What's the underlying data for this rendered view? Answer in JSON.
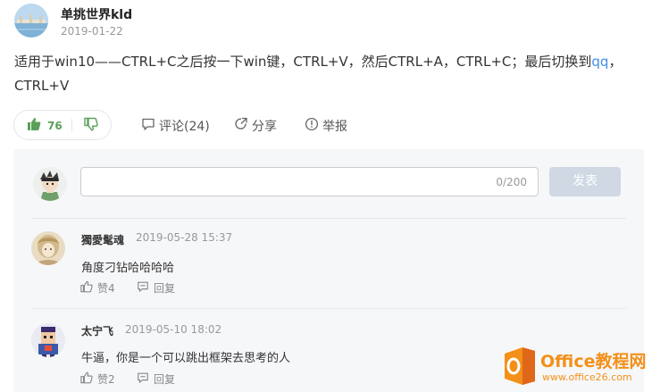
{
  "post": {
    "author": "单挑世界kld",
    "date": "2019-01-22",
    "body_main": "适用于win10——CTRL+C之后按一下win键，CTRL+V，然后CTRL+A，CTRL+C；最后切换到",
    "body_link": "qq",
    "body_tail": "，CTRL+V"
  },
  "actions": {
    "upvote_count": "76",
    "comment_label": "评论(24)",
    "share_label": "分享",
    "report_label": "举报"
  },
  "composer": {
    "counter": "0/200",
    "publish_label": "发表"
  },
  "comments": [
    {
      "user": "獨愛髦魂",
      "time": "2019-05-28 15:37",
      "text": "角度刁钻哈哈哈哈",
      "likes": "赞4",
      "reply": "回复"
    },
    {
      "user": "太宁飞",
      "time": "2019-05-10 18:02",
      "text": "牛逼，你是一个可以跳出框架去思考的人",
      "likes": "赞2",
      "reply": "回复"
    }
  ],
  "watermark": {
    "title": "Office教程网",
    "url": "www.office26.com"
  },
  "colors": {
    "accent_blue": "#3e8ee8",
    "upvote_green": "#5aa05a",
    "downvote_green": "#5aa05a",
    "publish_disabled": "#cfd8e3",
    "watermark_orange": "#f39019"
  },
  "icons": {
    "upvote": "thumbs-up-icon",
    "downvote": "thumbs-down-icon",
    "comment": "comment-bubble-icon",
    "share": "share-icon",
    "report": "exclamation-circle-icon",
    "like": "thumbs-up-outline-icon",
    "reply": "reply-bubble-icon"
  }
}
